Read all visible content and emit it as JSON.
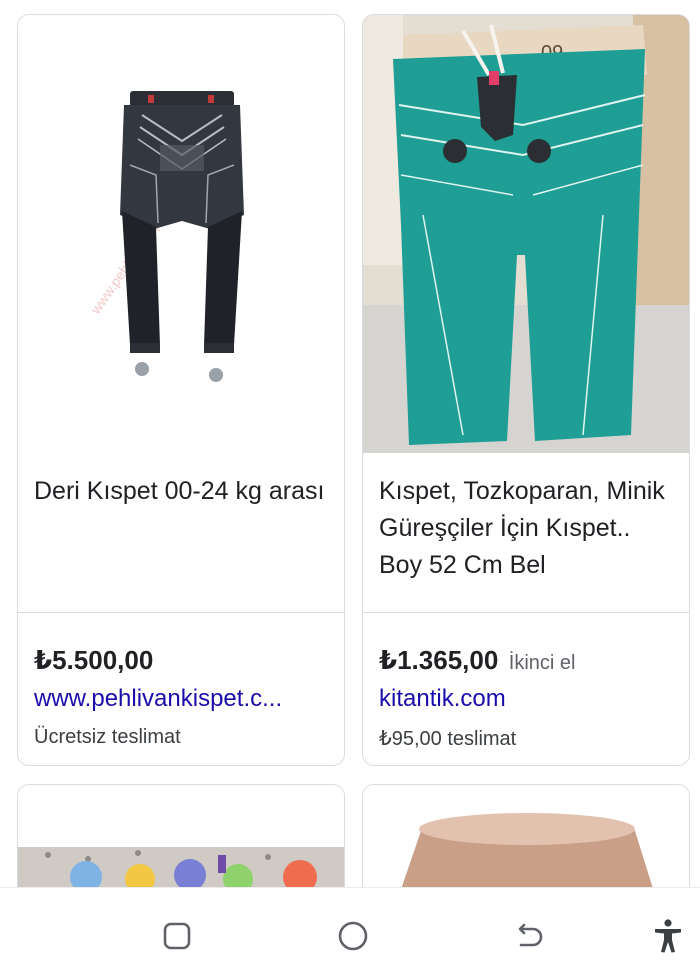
{
  "results": [
    {
      "title": "Deri Kıspet 00-24 kg arası",
      "price": "₺5.500,00",
      "condition": "",
      "merchant": "www.pehlivankispet.c...",
      "delivery": "Ücretsiz teslimat"
    },
    {
      "title": "Kıspet, Tozkoparan, Minik Güreşçiler İçin Kıspet.. Boy 52 Cm Bel",
      "price": "₺1.365,00",
      "condition": "İkinci el",
      "merchant": "kitantik.com",
      "delivery": "₺95,00 teslimat"
    }
  ],
  "navbar": {
    "icons": [
      "recent-apps-icon",
      "home-icon",
      "back-icon",
      "accessibility-icon"
    ]
  }
}
